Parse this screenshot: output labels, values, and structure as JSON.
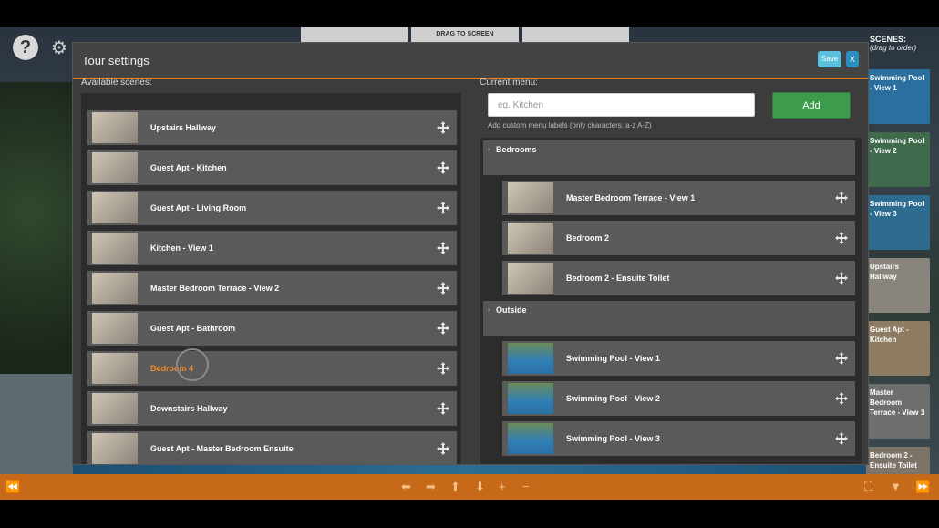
{
  "top_tabs": [
    "",
    "DRAG TO SCREEN",
    ""
  ],
  "scenes_strip": {
    "title": "SCENES:",
    "subtitle": "(drag to order)",
    "items": [
      {
        "label": "Swimming Pool - View 1",
        "color": "#2b6f9e"
      },
      {
        "label": "Swimming Pool - View 2",
        "color": "#3f6b4c"
      },
      {
        "label": "Swimming Pool - View 3",
        "color": "#2e6c8f"
      },
      {
        "label": "Upstairs Hallway",
        "color": "#8a857c"
      },
      {
        "label": "Guest Apt - Kitchen",
        "color": "#8d7c62"
      },
      {
        "label": "Master Bedroom Terrace - View 1",
        "color": "#6d6f6c"
      },
      {
        "label": "Bedroom 2 - Ensuite Toilet",
        "color": "#7c7468"
      }
    ]
  },
  "modal": {
    "title": "Tour settings",
    "save_label": "Save",
    "close_label": "X",
    "available_label": "Available scenes:",
    "current_label": "Current menu:",
    "input_placeholder": "eg. Kitchen",
    "add_label": "Add",
    "hint": "Add custom menu labels (only characters: a-z A-Z)"
  },
  "available_scenes": [
    {
      "label": "Upstairs Hallway",
      "active": false
    },
    {
      "label": "Guest Apt - Kitchen",
      "active": false
    },
    {
      "label": "Guest Apt - Living Room",
      "active": false
    },
    {
      "label": "Kitchen - View 1",
      "active": false
    },
    {
      "label": "Master Bedroom Terrace - View 2",
      "active": false
    },
    {
      "label": "Guest Apt - Bathroom",
      "active": false
    },
    {
      "label": "Bedroom 4",
      "active": true
    },
    {
      "label": "Downstairs Hallway",
      "active": false
    },
    {
      "label": "Guest Apt - Master Bedroom Ensuite",
      "active": false
    }
  ],
  "current_menu": [
    {
      "group": "Bedrooms",
      "toggle": "-",
      "items": [
        "Master Bedroom Terrace - View 1",
        "Bedroom 2",
        "Bedroom 2 - Ensuite Toilet"
      ]
    },
    {
      "group": "Outside",
      "toggle": "-",
      "items": [
        "Swimming Pool - View 1",
        "Swimming Pool - View 2",
        "Swimming Pool - View 3"
      ]
    }
  ],
  "colors": {
    "accent": "#e07a1e",
    "toolbar": "#c66a1a",
    "active_label": "#f28c28",
    "add_button": "#3e9a4c",
    "save_button": "#5bc0de"
  }
}
